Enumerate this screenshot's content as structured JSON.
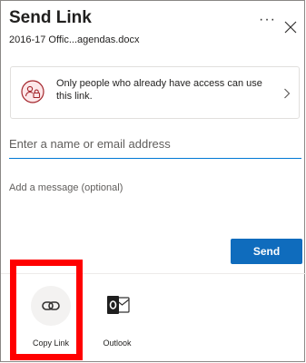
{
  "dialog": {
    "title": "Send Link",
    "filename": "2016-17 Offic...agendas.docx",
    "more_label": "···"
  },
  "permission": {
    "text": "Only people who already have access can use this link.",
    "icon": "people-lock-icon"
  },
  "recipient": {
    "placeholder": "Enter a name or email address"
  },
  "message": {
    "placeholder": "Add a message (optional)"
  },
  "send": {
    "label": "Send",
    "color": "#0f6cbd"
  },
  "share_options": [
    {
      "label": "Copy Link",
      "icon": "link-icon"
    },
    {
      "label": "Outlook",
      "icon": "outlook-icon"
    }
  ],
  "highlight_color": "#ff0000"
}
